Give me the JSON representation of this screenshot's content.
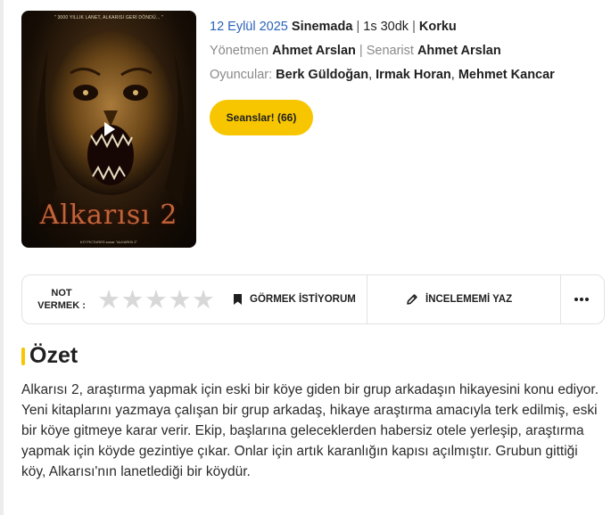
{
  "poster": {
    "tagline": "\" 3000 YILLIK LANET, ALKARISI GERİ DÖNDÜ... \"",
    "title": "Alkarısı 2",
    "credit": "KIT PICTURES sunar \"ALKARISI 2\""
  },
  "info": {
    "date": "12 Eylül 2025",
    "status": "Sinemada",
    "sep1": "|",
    "duration": "1s 30dk",
    "sep2": "|",
    "genre": "Korku",
    "director_label": "Yönetmen",
    "director": "Ahmet Arslan",
    "sep3": "|",
    "writer_label": "Senarist",
    "writer": "Ahmet Arslan",
    "cast_label": "Oyuncular:",
    "cast": [
      "Berk Güldoğan",
      "Irmak Horan",
      "Mehmet Kancar"
    ],
    "cast_sep": ","
  },
  "sessions_button": "Seanslar! (66)",
  "rating": {
    "label_line1": "NOT",
    "label_line2": "VERMEK :",
    "stars": [
      "★",
      "★",
      "★",
      "★",
      "★"
    ],
    "value": 0,
    "max": 5
  },
  "actions": {
    "watchlist": "GÖRMEK İSTİYORUM",
    "review": "İNCELEMEMİ YAZ"
  },
  "summary": {
    "heading": "Özet",
    "text": "Alkarısı 2, araştırma yapmak için eski bir köye giden bir grup arkadaşın hikayesini konu ediyor. Yeni kitaplarını yazmaya çalışan bir grup arkadaş, hikaye araştırma amacıyla terk edilmiş, eski bir köye gitmeye karar verir. Ekip, başlarına geleceklerden habersiz otele yerleşip, araştırma yapmak için köyde gezintiye çıkar. Onlar için artık karanlığın kapısı açılmıştır. Grubun gittiği köy, Alkarısı'nın lanetlediği bir köydür."
  },
  "colors": {
    "accent": "#f7c600",
    "date_link": "#2b63b8",
    "star_empty": "#d8d8d8"
  }
}
